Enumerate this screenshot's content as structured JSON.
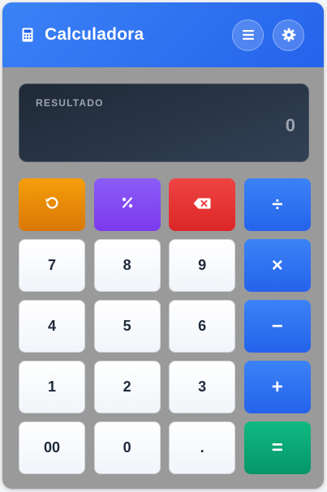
{
  "header": {
    "title": "Calculadora",
    "menu_icon": "menu-icon",
    "settings_icon": "settings-icon"
  },
  "display": {
    "label": "RESULTADO",
    "value": "0"
  },
  "keys": {
    "reset_icon": "reset-icon",
    "percent_icon": "percent-icon",
    "backspace_icon": "backspace-icon",
    "divide": "÷",
    "multiply": "×",
    "subtract": "−",
    "add": "+",
    "equals": "=",
    "seven": "7",
    "eight": "8",
    "nine": "9",
    "four": "4",
    "five": "5",
    "six": "6",
    "one": "1",
    "two": "2",
    "three": "3",
    "double_zero": "00",
    "zero": "0",
    "decimal": "."
  },
  "colors": {
    "header": "#2563eb",
    "reset": "#f59e0b",
    "percent": "#8b5cf6",
    "backspace": "#ef4444",
    "operator": "#3b82f6",
    "equals": "#10b981",
    "display": "#1f2937"
  }
}
